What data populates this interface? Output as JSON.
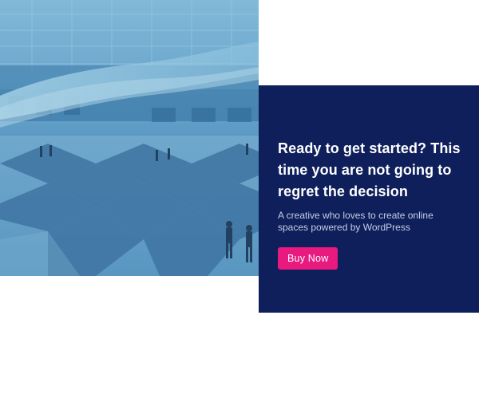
{
  "cta": {
    "heading": "Ready to get started? This time you are not going to regret the decision",
    "subtext": "A creative who loves to create online spaces powered by WordPress",
    "button_label": "Buy Now"
  },
  "colors": {
    "panel": "#0e1f5b",
    "button": "#e8197f",
    "photo_tint": "#4a90c2"
  }
}
